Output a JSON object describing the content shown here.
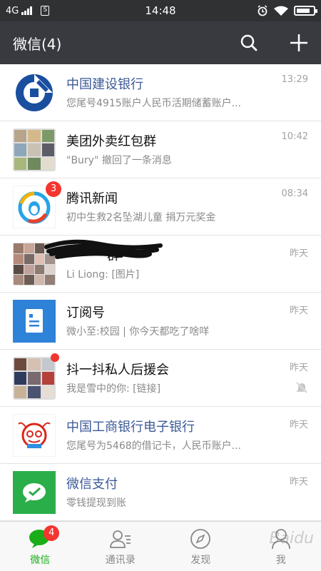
{
  "status_bar": {
    "network": "4G",
    "time": "14:48"
  },
  "header": {
    "title": "微信(4)"
  },
  "chats": [
    {
      "name": "中国建设银行",
      "message": "您尾号4915账户人民币活期储蓄账户...",
      "time": "13:29",
      "official": true
    },
    {
      "name": "美团外卖红包群",
      "message": "\"Bury\" 撤回了一条消息",
      "time": "10:42",
      "official": false
    },
    {
      "name": "腾讯新闻",
      "message": "初中生救2名坠湖儿童 捐万元奖金",
      "time": "08:34",
      "official": false,
      "badge": "3"
    },
    {
      "name": "群",
      "message": "Li Liong: [图片]",
      "time": "昨天",
      "official": false
    },
    {
      "name": "订阅号",
      "message": "微小至:校园 | 你今天都吃了啥咩",
      "time": "昨天",
      "official": false
    },
    {
      "name": "抖一抖私人后援会",
      "message": "我是雪中的你: [链接]",
      "time": "昨天",
      "official": false,
      "dot": true,
      "muted": true
    },
    {
      "name": "中国工商银行电子银行",
      "message": "您尾号为5468的借记卡，人民币账户...",
      "time": "昨天",
      "official": true
    },
    {
      "name": "微信支付",
      "message": "零钱提现到账",
      "time": "昨天",
      "official": true
    }
  ],
  "tabs": [
    {
      "label": "微信",
      "badge": "4"
    },
    {
      "label": "通讯录"
    },
    {
      "label": "发现"
    },
    {
      "label": "我"
    }
  ],
  "watermark": "Baidu",
  "colors": {
    "accent_green": "#1aad19",
    "badge_red": "#f43530",
    "header_bg": "#393a3f",
    "official_blue": "#3c5a99"
  }
}
